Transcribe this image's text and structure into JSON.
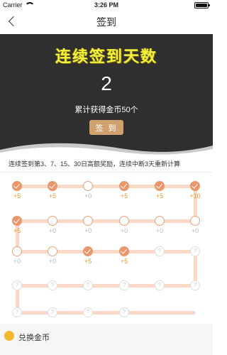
{
  "status_bar": {
    "carrier": "Carrier",
    "time": "3:26 PM"
  },
  "nav": {
    "title": "签到"
  },
  "hero": {
    "title": "连续签到天数",
    "count": "2",
    "total_text": "累计获得金币50个",
    "button_label": "签 到"
  },
  "rule": "连续签到第3、7、15、30日高额奖励，连续中断3天重新计算",
  "track_color": "#fbd9c8",
  "days": [
    {
      "state": "signed",
      "reward": "+5"
    },
    {
      "state": "signed",
      "reward": "+5"
    },
    {
      "state": "empty",
      "reward": "+0"
    },
    {
      "state": "signed",
      "reward": "+5"
    },
    {
      "state": "signed",
      "reward": "+5"
    },
    {
      "state": "signed",
      "reward": "+10"
    },
    {
      "state": "empty",
      "reward": "+0"
    },
    {
      "state": "empty",
      "reward": "+0"
    },
    {
      "state": "empty",
      "reward": "+0"
    },
    {
      "state": "empty",
      "reward": "+0"
    },
    {
      "state": "empty",
      "reward": "+0"
    },
    {
      "state": "signed",
      "reward": "+5"
    },
    {
      "state": "empty",
      "reward": "+0"
    },
    {
      "state": "empty",
      "reward": "+0"
    },
    {
      "state": "signed",
      "reward": "+5"
    },
    {
      "state": "signed",
      "reward": "+5"
    },
    {
      "state": "unknown",
      "reward": ""
    },
    {
      "state": "unknown",
      "reward": ""
    },
    {
      "state": "unknown",
      "reward": ""
    },
    {
      "state": "unknown",
      "reward": ""
    },
    {
      "state": "unknown",
      "reward": ""
    },
    {
      "state": "unknown",
      "reward": ""
    },
    {
      "state": "unknown",
      "reward": ""
    },
    {
      "state": "unknown",
      "reward": ""
    },
    {
      "state": "unknown",
      "reward": ""
    },
    {
      "state": "unknown",
      "reward": ""
    },
    {
      "state": "unknown",
      "reward": ""
    },
    {
      "state": "unknown",
      "reward": ""
    }
  ],
  "bottom": {
    "label": "兑换金币"
  }
}
